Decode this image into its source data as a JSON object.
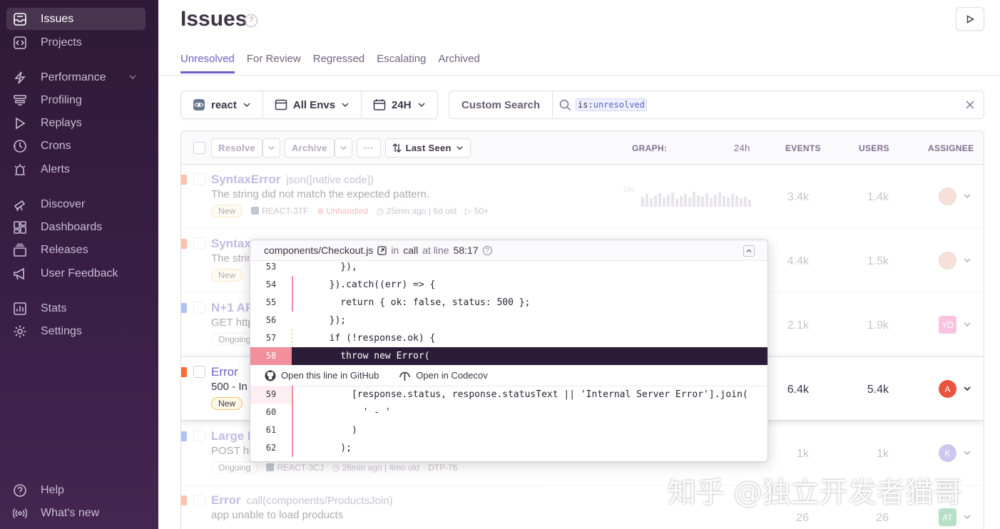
{
  "sidebar": {
    "items": [
      {
        "label": "Issues",
        "icon": "inbox-icon",
        "active": true
      },
      {
        "label": "Projects",
        "icon": "code-icon"
      },
      {
        "label": "Performance",
        "icon": "lightning-icon"
      },
      {
        "label": "Profiling",
        "icon": "profiling-icon"
      },
      {
        "label": "Replays",
        "icon": "play-icon"
      },
      {
        "label": "Crons",
        "icon": "clock-icon"
      },
      {
        "label": "Alerts",
        "icon": "siren-icon"
      },
      {
        "label": "Discover",
        "icon": "telescope-icon"
      },
      {
        "label": "Dashboards",
        "icon": "dashboard-icon"
      },
      {
        "label": "Releases",
        "icon": "package-icon"
      },
      {
        "label": "User Feedback",
        "icon": "megaphone-icon"
      },
      {
        "label": "Stats",
        "icon": "stats-icon"
      },
      {
        "label": "Settings",
        "icon": "gear-icon"
      },
      {
        "label": "Help",
        "icon": "question-icon"
      },
      {
        "label": "What's new",
        "icon": "broadcast-icon"
      }
    ]
  },
  "header": {
    "title": "Issues",
    "help": "?"
  },
  "tabs": [
    "Unresolved",
    "For Review",
    "Regressed",
    "Escalating",
    "Archived"
  ],
  "filters": {
    "project": "react",
    "env": "All Envs",
    "period": "24H"
  },
  "search": {
    "button": "Custom Search",
    "token_key": "is",
    "token_sep": ":",
    "token_value": "unresolved"
  },
  "table_header": {
    "resolve": "Resolve",
    "archive": "Archive",
    "more": "···",
    "sort": "Last Seen",
    "graph": "GRAPH:",
    "period": "24h",
    "events": "EVENTS",
    "users": "USERS",
    "assignee": "ASSIGNEE"
  },
  "issues": [
    {
      "title": "SyntaxError",
      "sub": "json([native code])",
      "msg": "The string did not match the expected pattern.",
      "status": "New",
      "short_id": "REACT-3TF",
      "handled": "Unhandled",
      "time": "25min ago",
      "age": "6d old",
      "replays": "50+",
      "events": "3.4k",
      "users": "1.4k",
      "graph_max": "240",
      "assignee": ""
    },
    {
      "title": "Syntax",
      "msg": "The strin",
      "status": "New",
      "events": "4.4k",
      "users": "1.5k",
      "assignee": ""
    },
    {
      "title": "N+1 AP",
      "msg": "GET http",
      "status": "Ongoing",
      "events": "2.1k",
      "users": "1.9k",
      "assignee": "YD"
    },
    {
      "title": "Error",
      "msg": "500 - In",
      "status": "New",
      "events": "6.4k",
      "users": "5.4k",
      "assignee": "A"
    },
    {
      "title": "Large I",
      "msg": "POST htt",
      "status": "Ongoing",
      "short_id": "REACT-3CJ",
      "time": "26min ago",
      "age": "4mo old",
      "extra": "DTP-76",
      "events": "1k",
      "users": "1k",
      "assignee": "K"
    },
    {
      "title": "Error",
      "sub": "call(components/ProductsJoin)",
      "msg": "app unable to load products",
      "events": "26",
      "users": "26",
      "assignee": "AT"
    }
  ],
  "popup": {
    "file": "components/Checkout.js",
    "in": "in",
    "func": "call",
    "at": "at line",
    "pos": "58:17",
    "help": "?",
    "github": "Open this line in GitHub",
    "codecov": "Open in Codecov",
    "lines_before": [
      {
        "n": "53",
        "code": "    }),"
      },
      {
        "n": "54",
        "code": "  }).catch((err) => {"
      },
      {
        "n": "55",
        "code": "    return { ok: false, status: 500 };"
      },
      {
        "n": "56",
        "code": "  });"
      },
      {
        "n": "57",
        "code": "  if (!response.ok) {"
      }
    ],
    "hot_line": {
      "n": "58",
      "code": "    throw new Error("
    },
    "lines_after": [
      {
        "n": "59",
        "code": "      [response.status, response.statusText || 'Internal Server Error'].join("
      },
      {
        "n": "60",
        "code": "        ' - '"
      },
      {
        "n": "61",
        "code": "      )"
      },
      {
        "n": "62",
        "code": "    );"
      }
    ]
  },
  "watermark": "知乎 @独立开发者猫哥",
  "colors": {
    "accent": "#6c5fc7",
    "sidebar": "#2f1937",
    "error_level": "#f86c33",
    "hot_line": "#2b1d38"
  }
}
